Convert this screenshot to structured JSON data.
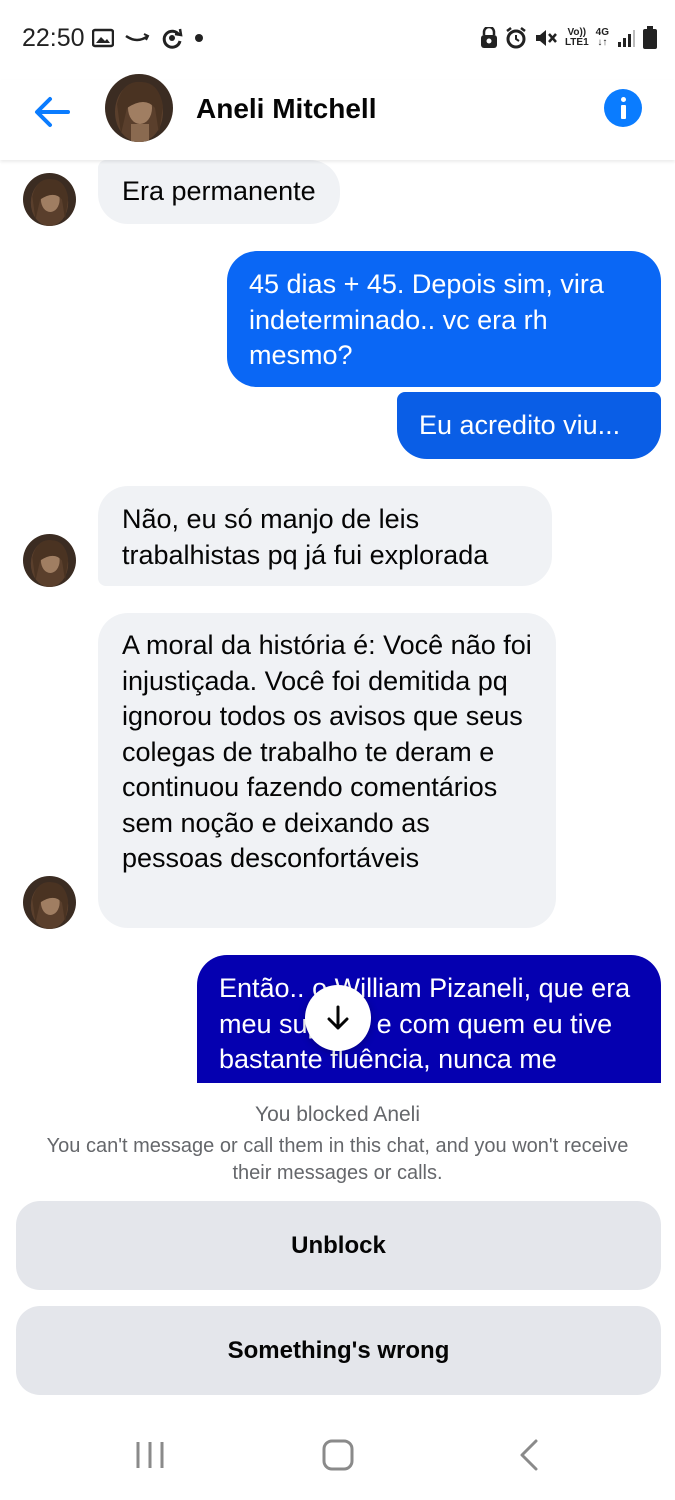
{
  "status_bar": {
    "time": "22:50",
    "left_icons": [
      "gallery-icon",
      "amazon-icon",
      "sync-icon",
      "dot-icon"
    ],
    "right_icons": [
      "privacy-icon",
      "alarm-icon",
      "mute-icon",
      "volte-icon",
      "network-4g-icon",
      "signal-icon",
      "battery-icon"
    ],
    "volte_top": "Vo))",
    "volte_bottom": "LTE1",
    "network_top": "4G",
    "network_bottom": "↓↑"
  },
  "header": {
    "contact_name": "Aneli Mitchell",
    "back_icon": "back-arrow-icon",
    "info_icon": "info-icon"
  },
  "messages": [
    {
      "direction": "in",
      "text": "Era permanente",
      "show_avatar": true
    },
    {
      "direction": "out",
      "text": "45 dias + 45. Depois sim, vira indeterminado.. vc era rh mesmo?"
    },
    {
      "direction": "out",
      "text": "Eu acredito viu..."
    },
    {
      "direction": "in",
      "text": "Não, eu só manjo de leis trabalhistas pq já fui explorada",
      "show_avatar": true
    },
    {
      "direction": "in",
      "text": "A moral da história é: Você não foi injustiçada. Você foi demitida pq ignorou todos os avisos que seus colegas de trabalho te deram e continuou fazendo comentários sem noção e deixando as pessoas desconfortáveis",
      "show_avatar": true
    },
    {
      "direction": "out",
      "text": "Então.. o William Pizaneli, que era meu suporte e com quem eu tive bastante fluência, nunca me chamou a atenção"
    }
  ],
  "blocked": {
    "title": "You blocked Aneli",
    "description": "You can't message or call them in this chat, and you won't receive their messages or calls.",
    "unblock_label": "Unblock",
    "wrong_label": "Something's wrong"
  },
  "colors": {
    "accent": "#0a7cff",
    "outgoing_gradient_top": "#0a7cff",
    "outgoing_gradient_bottom": "#0500b0",
    "incoming_bubble": "#f0f2f5",
    "button_bg": "#e4e6eb",
    "muted_text": "#65676b"
  }
}
